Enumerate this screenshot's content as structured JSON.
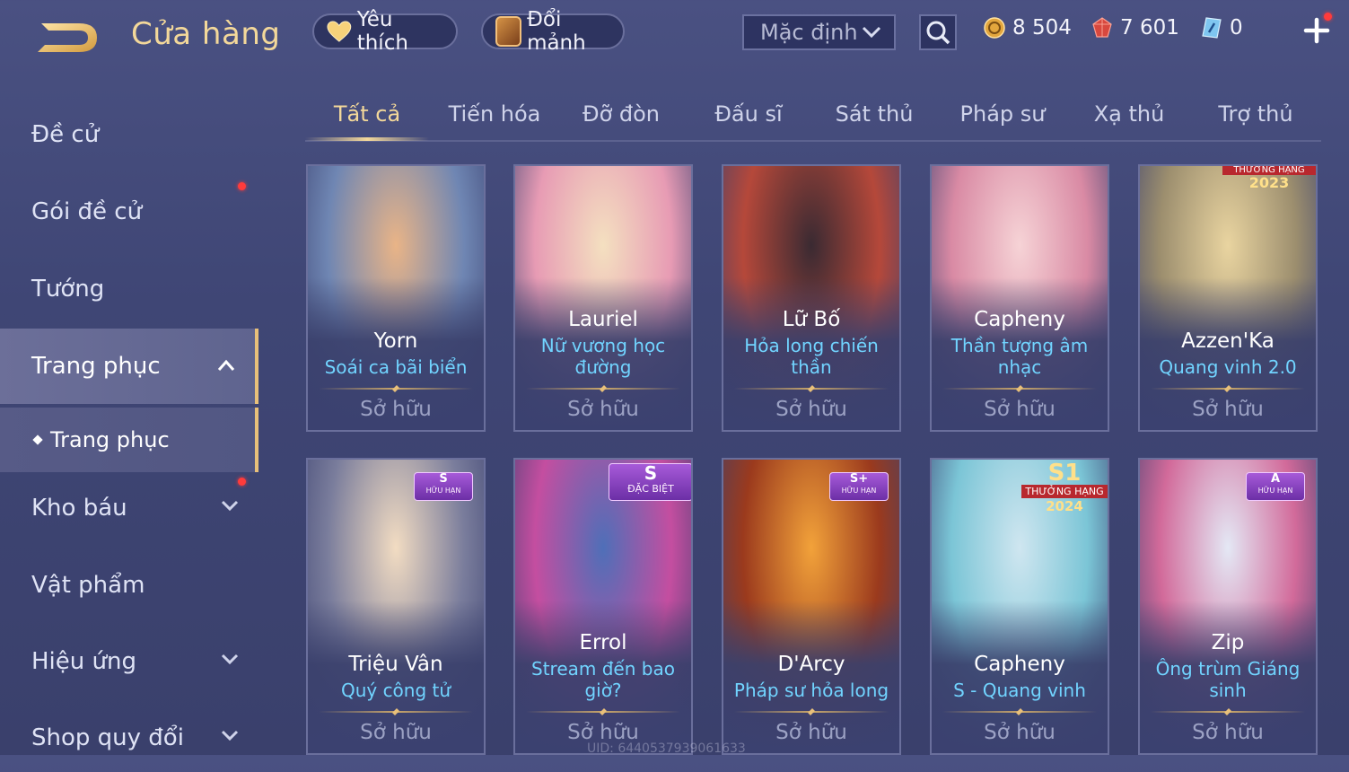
{
  "header": {
    "title": "Cửa hàng",
    "favorites_label": "Yêu thích",
    "exchange_label": "Đổi mảnh",
    "sort_value": "Mặc định",
    "currencies": [
      {
        "icon": "gold-coin-icon",
        "value": "8 504"
      },
      {
        "icon": "ruby-voucher-icon",
        "value": "7 601"
      },
      {
        "icon": "blue-crystal-icon",
        "value": "0"
      }
    ]
  },
  "sidebar": {
    "items": [
      {
        "label": "Đề cử"
      },
      {
        "label": "Gói đề cử"
      },
      {
        "label": "Tướng"
      },
      {
        "label": "Trang phục"
      },
      {
        "label": "Kho báu"
      },
      {
        "label": "Vật phẩm"
      },
      {
        "label": "Hiệu ứng"
      },
      {
        "label": "Shop quy đổi"
      }
    ],
    "subitem": "Trang phục"
  },
  "tabs": [
    "Tất cả",
    "Tiến hóa",
    "Đỡ đòn",
    "Đấu sĩ",
    "Sát thủ",
    "Pháp sư",
    "Xạ thủ",
    "Trợ thủ"
  ],
  "cards": [
    {
      "hero": "Yorn",
      "skin": "Soái ca bãi biển",
      "status": "Sở hữu",
      "colors": [
        "#e9b487",
        "#6f86b3"
      ]
    },
    {
      "hero": "Lauriel",
      "skin": "Nữ vương học đường",
      "status": "Sở hữu",
      "colors": [
        "#f4e0c0",
        "#e79bb4"
      ]
    },
    {
      "hero": "Lữ Bố",
      "skin": "Hỏa long chiến thần",
      "status": "Sở hữu",
      "colors": [
        "#3a2a32",
        "#b5483a"
      ]
    },
    {
      "hero": "Capheny",
      "skin": "Thần tượng âm nhạc",
      "status": "Sở hữu",
      "colors": [
        "#f6d3d6",
        "#d98aa4"
      ]
    },
    {
      "hero": "Azzen'Ka",
      "skin": "Quang vinh 2.0",
      "status": "Sở hữu",
      "colors": [
        "#e9d4a0",
        "#9c8e6e"
      ],
      "badge": {
        "top": "THƯỞNG HẠNG",
        "bottom": "2023"
      }
    },
    {
      "hero": "Triệu Vân",
      "skin": "Quý công tử",
      "status": "Sở hữu",
      "colors": [
        "#f2dcc2",
        "#7a7d9c"
      ],
      "badge": {
        "top": "S",
        "bottom": "HỮU HẠN"
      }
    },
    {
      "hero": "Errol",
      "skin": "Stream đến bao giờ?",
      "status": "Sở hữu",
      "colors": [
        "#4f6fb8",
        "#c44ea0"
      ],
      "badge": {
        "top": "S",
        "bottom": "ĐẶC BIỆT"
      }
    },
    {
      "hero": "D'Arcy",
      "skin": "Pháp sư hỏa long",
      "status": "Sở hữu",
      "colors": [
        "#f2a23a",
        "#9b3a1d"
      ],
      "badge": {
        "top": "S+",
        "bottom": "HỮU HẠN"
      }
    },
    {
      "hero": "Capheny",
      "skin": "S - Quang vinh",
      "status": "Sở hữu",
      "colors": [
        "#cfe6f0",
        "#7bc5d6"
      ],
      "badge": {
        "top": "S1",
        "middle": "THƯỞNG HẠNG",
        "bottom": "2024"
      }
    },
    {
      "hero": "Zip",
      "skin": "Ông trùm Giáng sinh",
      "status": "Sở hữu",
      "colors": [
        "#e4e8f5",
        "#d26a9a"
      ],
      "badge": {
        "top": "A",
        "bottom": "HỮU HẠN"
      }
    }
  ],
  "watermark": "UID: 6440537939061633"
}
